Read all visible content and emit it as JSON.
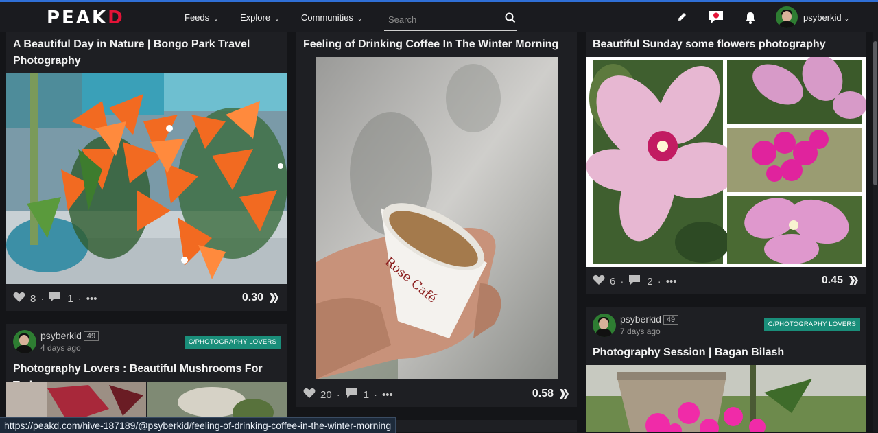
{
  "header": {
    "logo": "PEAK",
    "logo_accent": "D",
    "nav": [
      {
        "label": "Feeds",
        "icon": "chevron-down-icon"
      },
      {
        "label": "Explore",
        "icon": "chevron-down-icon"
      },
      {
        "label": "Communities",
        "icon": "chevron-down-icon"
      }
    ],
    "search_placeholder": "Search",
    "username": "psyberkid",
    "icons": [
      "pencil-icon",
      "chat-icon",
      "bell-icon",
      "search-icon"
    ]
  },
  "cards": [
    {
      "title_line1": "A Beautiful Day in Nature | Bongo Park Travel",
      "title_line2": "Photography",
      "votes": "8",
      "comments": "1",
      "payout": "0.30"
    },
    {
      "title": "Feeling of Drinking Coffee In The Winter Morning",
      "votes": "20",
      "comments": "1",
      "payout": "0.58",
      "cup_brand": "Rose Café"
    },
    {
      "title": "Beautiful Sunday some flowers photography",
      "votes": "6",
      "comments": "2",
      "payout": "0.45"
    },
    {
      "author": "psyberkid",
      "reputation": "49",
      "age": "4 days ago",
      "community": "C/PHOTOGRAPHY LOVERS",
      "title": "Photography Lovers : Beautiful Mushrooms For Today"
    },
    {
      "author": "psyberkid",
      "reputation": "49",
      "age": "7 days ago",
      "community": "C/PHOTOGRAPHY LOVERS",
      "title": "Photography Session | Bagan Bilash"
    }
  ],
  "more_label": "•••",
  "status_url": "https://peakd.com/hive-187189/@psyberkid/feeling-of-drinking-coffee-in-the-winter-morning",
  "colors": {
    "accent": "#e31337",
    "community_badge": "#1a8e7a",
    "background": "#141518"
  }
}
